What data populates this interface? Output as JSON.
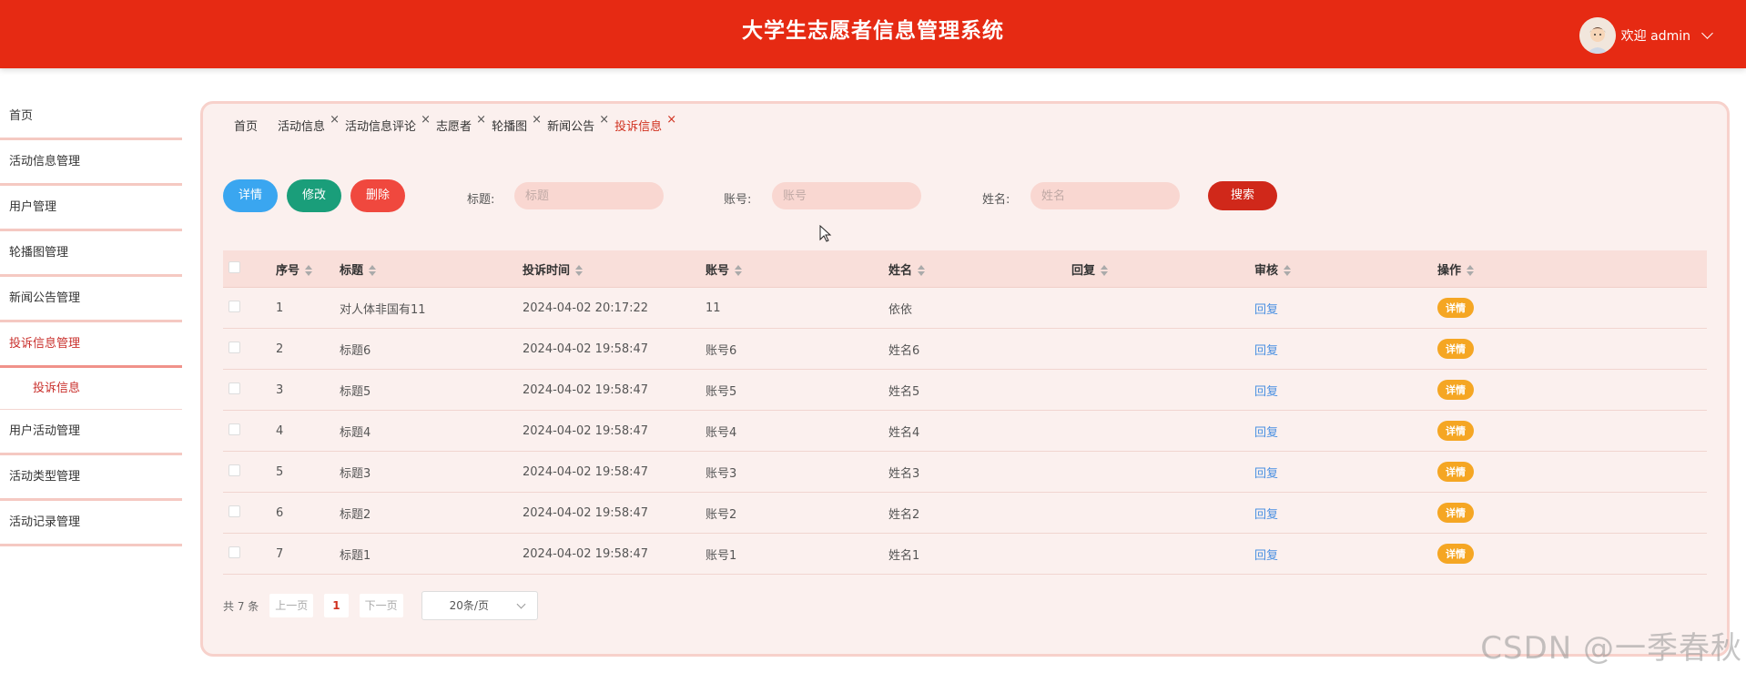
{
  "header": {
    "title": "大学生志愿者信息管理系统",
    "welcome": "欢迎 admin"
  },
  "sidebar": {
    "items": [
      {
        "label": "首页"
      },
      {
        "label": "活动信息管理"
      },
      {
        "label": "用户管理"
      },
      {
        "label": "轮播图管理"
      },
      {
        "label": "新闻公告管理"
      },
      {
        "label": "投诉信息管理"
      },
      {
        "label": "用户活动管理"
      },
      {
        "label": "活动类型管理"
      },
      {
        "label": "活动记录管理"
      }
    ],
    "active_sub": "投诉信息"
  },
  "tabs": [
    "首页",
    "活动信息",
    "活动信息评论",
    "志愿者",
    "轮播图",
    "新闻公告",
    "投诉信息"
  ],
  "toolbar": {
    "detail": "详情",
    "edit": "修改",
    "delete": "删除",
    "search": "搜索"
  },
  "filters": {
    "title_label": "标题:",
    "title_placeholder": "标题",
    "account_label": "账号:",
    "account_placeholder": "账号",
    "name_label": "姓名:",
    "name_placeholder": "姓名"
  },
  "table": {
    "headers": [
      "序号",
      "标题",
      "投诉时间",
      "账号",
      "姓名",
      "回复",
      "审核",
      "操作"
    ],
    "rows": [
      {
        "no": "1",
        "title": "对人体非国有11",
        "time": "2024-04-02 20:17:22",
        "account": "11",
        "name": "依依",
        "reply": "",
        "audit": "回复",
        "op": "详情"
      },
      {
        "no": "2",
        "title": "标题6",
        "time": "2024-04-02 19:58:47",
        "account": "账号6",
        "name": "姓名6",
        "reply": "",
        "audit": "回复",
        "op": "详情"
      },
      {
        "no": "3",
        "title": "标题5",
        "time": "2024-04-02 19:58:47",
        "account": "账号5",
        "name": "姓名5",
        "reply": "",
        "audit": "回复",
        "op": "详情"
      },
      {
        "no": "4",
        "title": "标题4",
        "time": "2024-04-02 19:58:47",
        "account": "账号4",
        "name": "姓名4",
        "reply": "",
        "audit": "回复",
        "op": "详情"
      },
      {
        "no": "5",
        "title": "标题3",
        "time": "2024-04-02 19:58:47",
        "account": "账号3",
        "name": "姓名3",
        "reply": "",
        "audit": "回复",
        "op": "详情"
      },
      {
        "no": "6",
        "title": "标题2",
        "time": "2024-04-02 19:58:47",
        "account": "账号2",
        "name": "姓名2",
        "reply": "",
        "audit": "回复",
        "op": "详情"
      },
      {
        "no": "7",
        "title": "标题1",
        "time": "2024-04-02 19:58:47",
        "account": "账号1",
        "name": "姓名1",
        "reply": "",
        "audit": "回复",
        "op": "详情"
      }
    ]
  },
  "pager": {
    "total": "共 7 条",
    "prev": "上一页",
    "page": "1",
    "next": "下一页",
    "page_size": "20条/页"
  },
  "watermark": "CSDN @一季春秋",
  "colors": {
    "header": "#e62a13",
    "detail_btn": "#3aa6f0",
    "edit_btn": "#1a9e7a",
    "delete_btn": "#f0483e",
    "search_btn": "#d0281a",
    "op_pill": "#f5a623"
  },
  "icons": {
    "avatar": "avatar-icon",
    "dropdown": "chevron-down-icon",
    "close": "close-icon",
    "sort": "sort-icon",
    "cursor": "cursor-icon"
  }
}
